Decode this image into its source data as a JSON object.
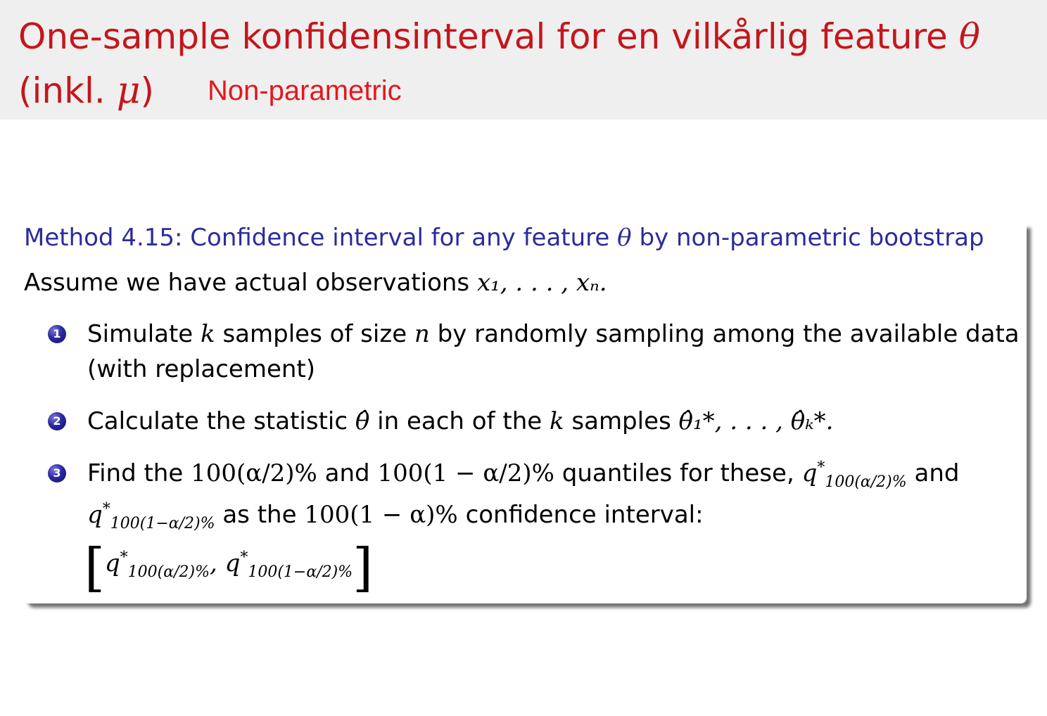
{
  "slide": {
    "title_line1": "One-sample konfidensinterval for en vilkårlig feature",
    "title_theta": "θ",
    "title_line2_open": "(inkl.",
    "title_mu": "μ",
    "title_line2_close": ")",
    "subtitle": "Non-parametric"
  },
  "method": {
    "heading_prefix": "Method 4.15: Confidence interval for any feature",
    "heading_theta": "θ",
    "heading_suffix": "by non-parametric bootstrap",
    "intro_text": "Assume we have actual observations",
    "intro_math": "x₁, . . . , xₙ.",
    "steps": [
      {
        "number": "1",
        "line1_a": "Simulate",
        "line1_k": "k",
        "line1_b": "samples of size",
        "line1_n": "n",
        "line1_c": "by randomly sampling among the available data",
        "line2": "(with replacement)"
      },
      {
        "number": "2",
        "text_a": "Calculate the statistic",
        "theta_hat": "θ̂",
        "text_b": "in each of the",
        "k": "k",
        "text_c": "samples",
        "samples_math": "θ̂₁*, . . . , θ̂ₖ*."
      },
      {
        "number": "3",
        "text_a": "Find the",
        "q_low_pct": "100(α/2)%",
        "text_and": "and",
        "q_high_pct": "100(1 − α/2)%",
        "text_b": "quantiles for these,",
        "q_low_sym": "q",
        "q_low_sub": "100(α/2)%",
        "text_and2": "and",
        "q_high_sym": "q",
        "q_high_sub": "100(1−α/2)%",
        "text_as": "as the",
        "conf_pct": "100(1 − α)%",
        "text_ci": "confidence interval:",
        "star": "*",
        "comma": ","
      }
    ]
  }
}
